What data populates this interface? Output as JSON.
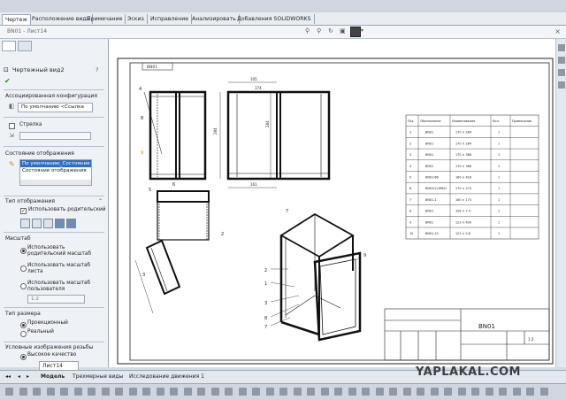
{
  "ribbon": {
    "tabs": [
      "Чертеж",
      "Расположение вида",
      "Примечание",
      "Эскиз",
      "Исправление",
      "Анализировать",
      "Добавления SOLIDWORKS"
    ],
    "active": 0
  },
  "document": {
    "title": "ВN01 - Лист14"
  },
  "panel": {
    "title": "Чертежный вид2",
    "config_header": "Ассоциированная конфигурация",
    "config_value": "По умолчанию <Ссылка",
    "arrow_label": "Стрелка",
    "display_state_header": "Состояние отображения",
    "display_states": [
      "По умолчанию_Состояние",
      "Состояние отображения"
    ],
    "display_type_header": "Тип отображения",
    "use_parent_style": "Использовать родительский",
    "scale_header": "Масштаб",
    "scale_opt1": "Использовать родительский масштаб",
    "scale_opt2": "Использовать масштаб листа",
    "scale_opt3": "Использовать масштаб пользователя",
    "scale_value": "1:2",
    "dim_type_header": "Тип размера",
    "dim_proj": "Проекционный",
    "dim_real": "Реальный",
    "thread_header": "Условные изображения резьбы",
    "thread_high": "Высокое качество"
  },
  "drawing": {
    "title_note": "ВN01",
    "stamp": "ВN01",
    "stamp_scale": "1:2",
    "spec_headers": [
      "Поз.",
      "Обозначение",
      "Наименование",
      "Кол.",
      "Примечание"
    ],
    "spec_rows": [
      [
        "1",
        "",
        "ВN01",
        "170 × 284",
        "1"
      ],
      [
        "2",
        "",
        "ВN01",
        "170 × 284",
        "1"
      ],
      [
        "3",
        "",
        "ВN01",
        "170 × 368",
        "1"
      ],
      [
        "4",
        "",
        "ВN01",
        "170 × 368",
        "1"
      ],
      [
        "5",
        "",
        "ВN01-68",
        "160 × 418",
        "1"
      ],
      [
        "6",
        "",
        "ВN01(2)-ВN01",
        "170 × 274",
        "1"
      ],
      [
        "7",
        "",
        "ВN01-1",
        "180 × 174",
        "1"
      ],
      [
        "8",
        "",
        "ВN01",
        "108 × 7.4",
        "1"
      ],
      [
        "9",
        "",
        "ВN01",
        "123 × 409",
        "1"
      ],
      [
        "10",
        "",
        "ВN01-10",
        "123 × 0.8",
        "1"
      ]
    ],
    "balloons": [
      "4",
      "8",
      "9",
      "5",
      "6",
      "2",
      "3",
      "7",
      "2",
      "1",
      "3",
      "8",
      "7",
      "9"
    ],
    "dims": [
      "105",
      "174",
      "284",
      "284",
      "161"
    ]
  },
  "sheet_tab": "Лист14",
  "bottom_tabs": [
    "Модель",
    "Трехмерные виды",
    "Исследование движения 1"
  ],
  "watermark": "YAPLAKAL.COM"
}
